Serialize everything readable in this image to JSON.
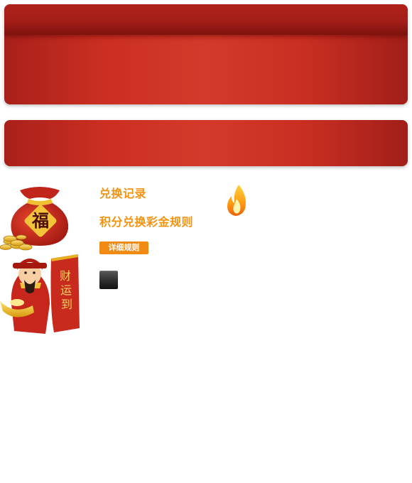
{
  "links": {
    "exchange_record": "兑换记录",
    "points_rules": "积分兑换彩金规则"
  },
  "buttons": {
    "detail_rules": "详细规则"
  },
  "art": {
    "bag_char": "福",
    "scroll_chars": [
      "财",
      "运",
      "到"
    ]
  },
  "colors": {
    "accent_orange": "#f29312",
    "panel_red": "#d4392a",
    "header_red": "#a41d17"
  }
}
